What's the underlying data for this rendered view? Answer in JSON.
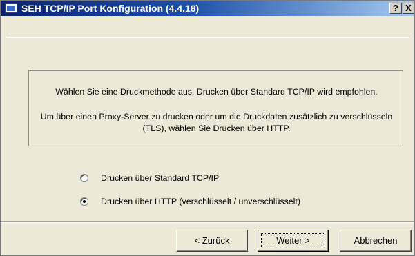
{
  "window": {
    "title": "SEH TCP/IP Port Konfiguration (4.4.18)",
    "help_label": "?",
    "close_label": "X"
  },
  "info": {
    "line1": "Wählen Sie eine Druckmethode aus. Drucken über Standard TCP/IP wird empfohlen.",
    "line2": "Um über einen Proxy-Server zu drucken oder um die Druckdaten zusätzlich zu verschlüsseln (TLS), wählen Sie Drucken über HTTP."
  },
  "options": [
    {
      "label": "Drucken über Standard TCP/IP",
      "checked": false
    },
    {
      "label": "Drucken über HTTP (verschlüsselt / unverschlüsselt)",
      "checked": true
    }
  ],
  "buttons": {
    "back": "< Zurück",
    "next": "Weiter >",
    "cancel": "Abbrechen"
  }
}
